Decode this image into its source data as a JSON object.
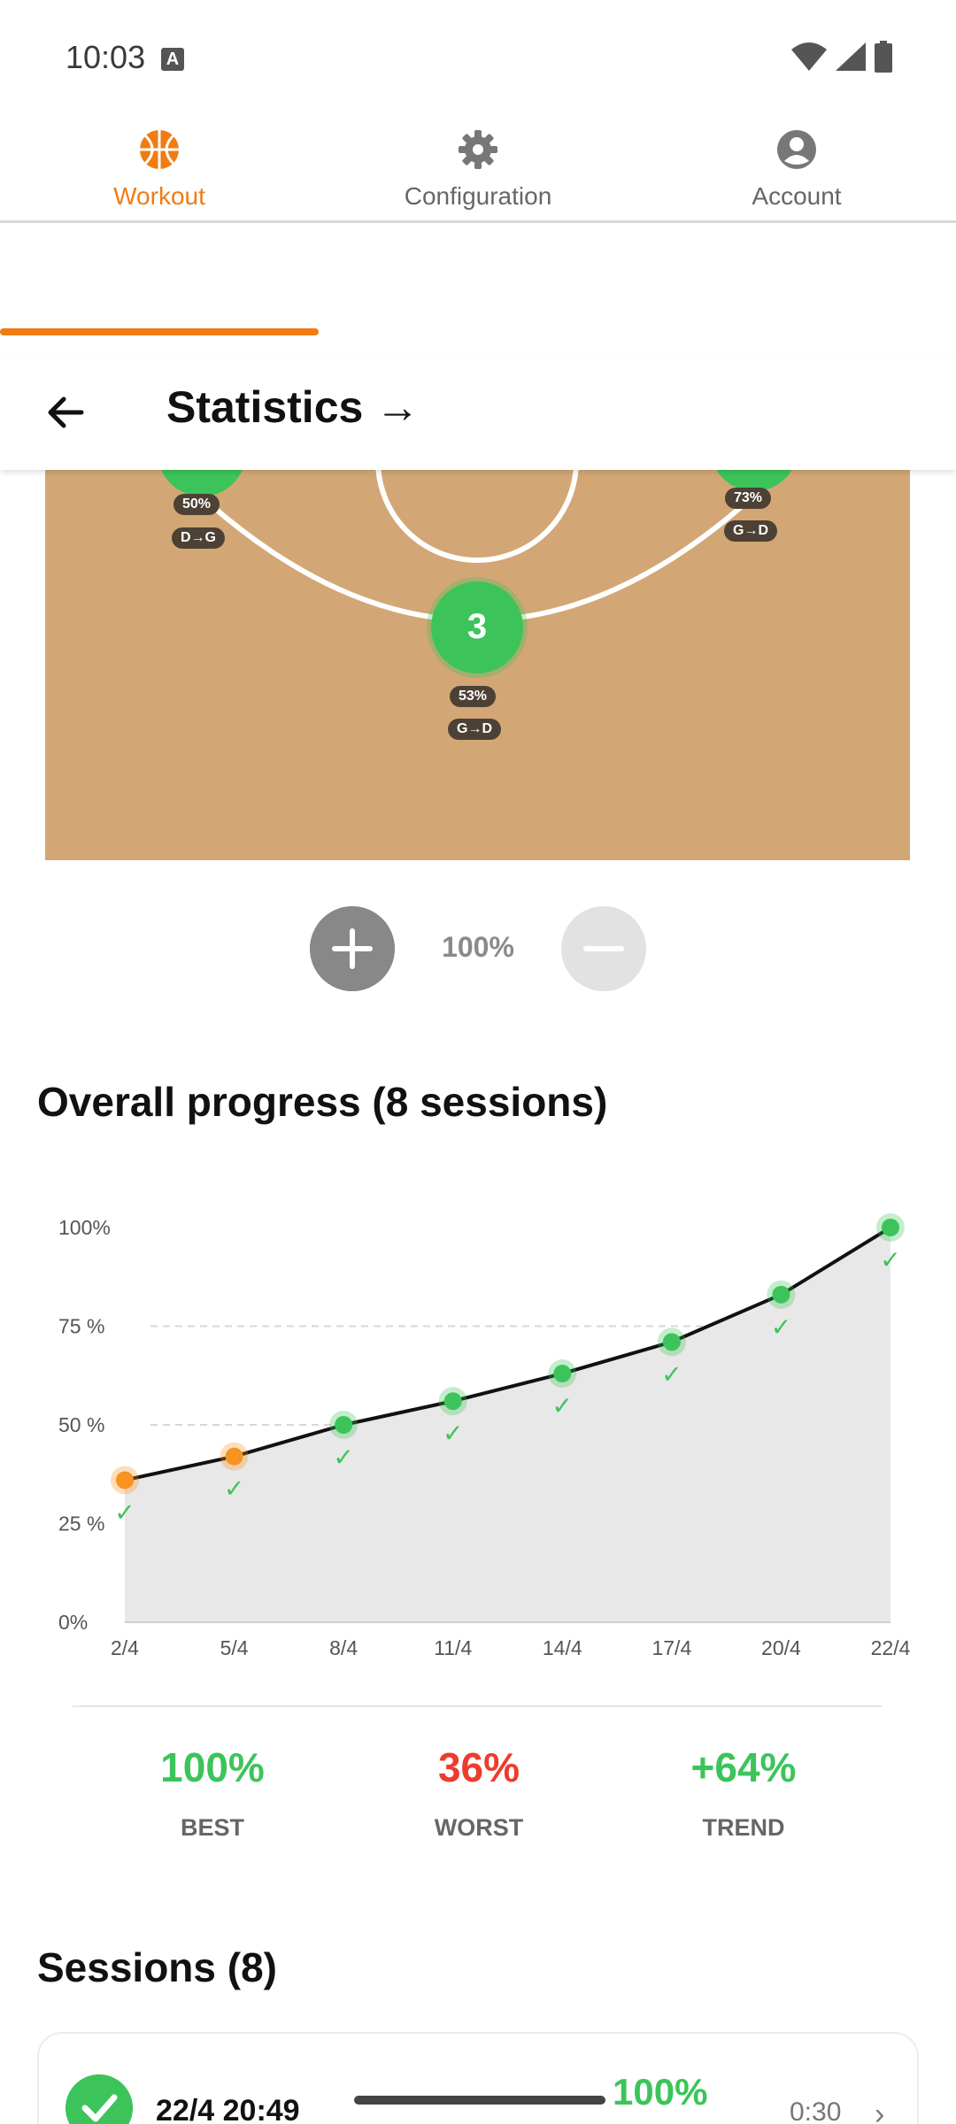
{
  "status_bar": {
    "time": "10:03",
    "notification_icon": "A"
  },
  "tabs": [
    {
      "label": "Workout",
      "icon": "basketball-icon",
      "active": true
    },
    {
      "label": "Configuration",
      "icon": "gear-icon",
      "active": false
    },
    {
      "label": "Account",
      "icon": "account-circle-icon",
      "active": false
    }
  ],
  "header": {
    "title": "Statistics →"
  },
  "court": {
    "spots": [
      {
        "number": "",
        "percent": "50%",
        "direction": "D→G"
      },
      {
        "number": "",
        "percent": "73%",
        "direction": "G→D"
      },
      {
        "number": "3",
        "percent": "53%",
        "direction": "G→D"
      }
    ]
  },
  "zoom": {
    "level": "100%"
  },
  "progress": {
    "title": "Overall progress (8 sessions)",
    "stats": [
      {
        "value": "100%",
        "label": "BEST",
        "color": "#3cc45a"
      },
      {
        "value": "36%",
        "label": "WORST",
        "color": "#ef3b2d"
      },
      {
        "value": "+64%",
        "label": "TREND",
        "color": "#3cc45a"
      }
    ]
  },
  "chart_data": {
    "type": "area",
    "x": [
      "2/4",
      "5/4",
      "8/4",
      "11/4",
      "14/4",
      "17/4",
      "20/4",
      "22/4"
    ],
    "values": [
      36,
      42,
      50,
      56,
      63,
      71,
      83,
      100
    ],
    "point_colors": [
      "#f7931e",
      "#f7931e",
      "#3cc45a",
      "#3cc45a",
      "#3cc45a",
      "#3cc45a",
      "#3cc45a",
      "#3cc45a"
    ],
    "ytick_labels": [
      "0%",
      "25 %",
      "50 %",
      "75 %",
      "100%"
    ],
    "ylim": [
      0,
      100
    ],
    "grid": true
  },
  "sessions": {
    "title": "Sessions (8)",
    "items": [
      {
        "date": "22/4 20:49",
        "percent": "100%",
        "duration": "0:30",
        "chevron": "›"
      }
    ]
  }
}
